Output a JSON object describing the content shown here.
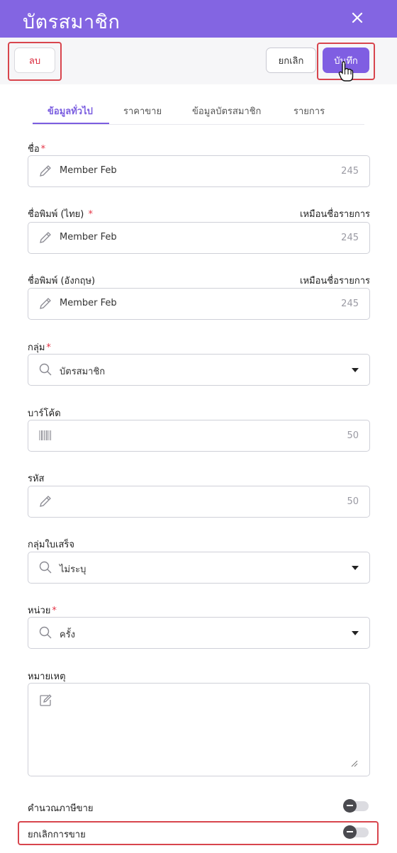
{
  "header": {
    "title": "บัตรสมาชิก"
  },
  "toolbar": {
    "delete_label": "ลบ",
    "cancel_label": "ยกเลิก",
    "save_label": "บันทึก"
  },
  "tabs": [
    {
      "label": "ข้อมูลทั่วไป",
      "active": true
    },
    {
      "label": "ราคาขาย",
      "active": false
    },
    {
      "label": "ข้อมูลบัตรสมาชิก",
      "active": false
    },
    {
      "label": "รายการ",
      "active": false
    }
  ],
  "form": {
    "name": {
      "label": "ชื่อ",
      "value": "Member Feb",
      "counter": "245"
    },
    "print_name_th": {
      "label": "ชื่อพิมพ์ (ไทย) ",
      "link": "เหมือนชื่อรายการ",
      "value": "Member Feb",
      "counter": "245"
    },
    "print_name_en": {
      "label": "ชื่อพิมพ์ (อังกฤษ)",
      "link": "เหมือนชื่อรายการ",
      "value": "Member Feb",
      "counter": "245"
    },
    "group": {
      "label": "กลุ่ม",
      "value": "บัตรสมาชิก"
    },
    "barcode": {
      "label": "บาร์โค้ด",
      "value": "",
      "counter": "50"
    },
    "code": {
      "label": "รหัส",
      "value": "",
      "counter": "50"
    },
    "receipt_group": {
      "label": "กลุ่มใบเสร็จ",
      "value": "ไม่ระบุ"
    },
    "unit": {
      "label": "หน่วย",
      "value": "ครั้ง"
    },
    "note": {
      "label": "หมายเหตุ",
      "value": ""
    },
    "calc_tax": {
      "label": "คำนวณภาษีขาย",
      "enabled": false
    },
    "cancel_sale": {
      "label": "ยกเลิกการขาย",
      "enabled": false
    },
    "required_mark": "*"
  },
  "colors": {
    "header": "#8365e2",
    "accent": "#7f5ee2",
    "danger": "#d9263a",
    "highlight": "#d8454d"
  },
  "icons": {
    "close": "close-icon",
    "edit": "pencil-icon",
    "search": "search-icon",
    "barcode": "barcode-icon",
    "note": "edit-note-icon",
    "cursor": "hand-cursor-icon"
  }
}
